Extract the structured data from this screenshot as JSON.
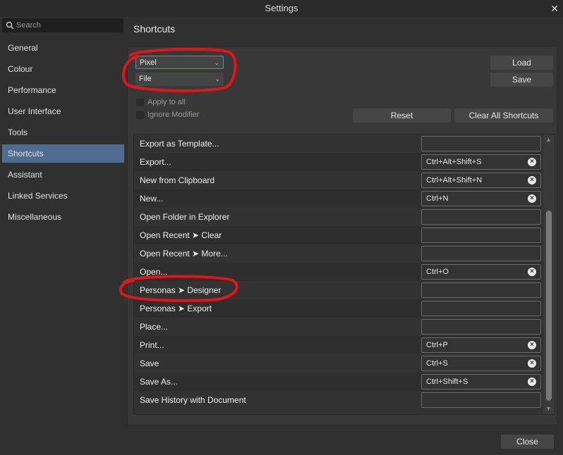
{
  "window": {
    "title": "Settings",
    "close_label": "✕"
  },
  "search": {
    "placeholder": "Search"
  },
  "sidebar": {
    "items": [
      {
        "label": "General"
      },
      {
        "label": "Colour"
      },
      {
        "label": "Performance"
      },
      {
        "label": "User Interface"
      },
      {
        "label": "Tools"
      },
      {
        "label": "Shortcuts",
        "selected": true
      },
      {
        "label": "Assistant"
      },
      {
        "label": "Linked Services"
      },
      {
        "label": "Miscellaneous"
      }
    ]
  },
  "main": {
    "title": "Shortcuts",
    "persona_select": "Pixel",
    "category_select": "File",
    "load_label": "Load",
    "save_label": "Save",
    "apply_to_all": "Apply to all",
    "ignore_modifier": "Ignore Modifier",
    "reset_label": "Reset",
    "clear_all_label": "Clear All Shortcuts",
    "shortcuts": [
      {
        "name": "Export as Template...",
        "key": ""
      },
      {
        "name": "Export...",
        "key": "Ctrl+Alt+Shift+S"
      },
      {
        "name": "New from Clipboard",
        "key": "Ctrl+Alt+Shift+N"
      },
      {
        "name": "New...",
        "key": "Ctrl+N"
      },
      {
        "name": "Open Folder in Explorer",
        "key": ""
      },
      {
        "name": "Open Recent ➤ Clear",
        "key": ""
      },
      {
        "name": "Open Recent ➤ More...",
        "key": ""
      },
      {
        "name": "Open...",
        "key": "Ctrl+O"
      },
      {
        "name": "Personas ➤ Designer",
        "key": ""
      },
      {
        "name": "Personas ➤ Export",
        "key": ""
      },
      {
        "name": "Place...",
        "key": ""
      },
      {
        "name": "Print...",
        "key": "Ctrl+P"
      },
      {
        "name": "Save",
        "key": "Ctrl+S"
      },
      {
        "name": "Save As...",
        "key": "Ctrl+Shift+S"
      },
      {
        "name": "Save History with Document",
        "key": ""
      }
    ]
  },
  "footer": {
    "close_label": "Close"
  },
  "colors": {
    "accent": "#4d6c8f",
    "annotation": "#e0161b"
  }
}
